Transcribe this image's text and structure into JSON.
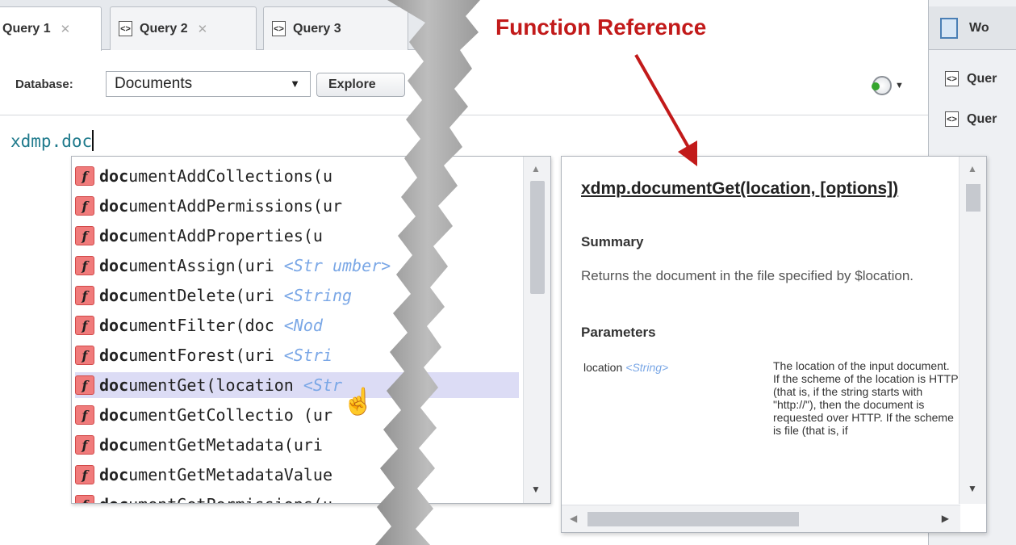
{
  "tabs": [
    {
      "label": "Query 1",
      "active": true
    },
    {
      "label": "Query 2",
      "active": false
    },
    {
      "label": "Query 3",
      "active": false
    }
  ],
  "toolbar": {
    "database_label": "Database:",
    "database_value": "Documents",
    "explore_label": "Explore"
  },
  "editor": {
    "code": "xdmp.doc"
  },
  "autocomplete": {
    "typed_prefix": "doc",
    "items": [
      {
        "rest": "umentAddCollections(u",
        "param": "",
        "selected": false
      },
      {
        "rest": "umentAddPermissions(ur",
        "param": "",
        "selected": false
      },
      {
        "rest": "umentAddProperties(u",
        "param": "",
        "selected": false
      },
      {
        "rest": "umentAssign(uri",
        "param": "<Str          umber>",
        "selected": false
      },
      {
        "rest": "umentDelete(uri",
        "param": "<String",
        "selected": false
      },
      {
        "rest": "umentFilter(doc",
        "param": "<Nod",
        "selected": false
      },
      {
        "rest": "umentForest(uri",
        "param": "<Stri",
        "selected": false
      },
      {
        "rest": "umentGet(location",
        "param": "<Str",
        "selected": true
      },
      {
        "rest": "umentGetCollectio  (ur",
        "param": "",
        "selected": false
      },
      {
        "rest": "umentGetMetadata(uri",
        "param": "",
        "selected": false
      },
      {
        "rest": "umentGetMetadataValue",
        "param": "",
        "selected": false
      },
      {
        "rest": "umentGetPermissions(u",
        "param": "",
        "selected": false
      }
    ]
  },
  "workspace": {
    "title": "Wo",
    "items": [
      "Quer",
      "Quer"
    ]
  },
  "doc_popup": {
    "title": "xdmp.documentGet(location, [options])",
    "summary_heading": "Summary",
    "summary_text": "Returns the document in the file specified by $location.",
    "parameters_heading": "Parameters",
    "param_name": "location",
    "param_type": "<String>",
    "param_desc": "The location of the input document. If the scheme of the location is HTTP (that is, if the string starts with \"http://\"), then the document is requested over HTTP. If the scheme is file (that is, if"
  },
  "annotation": {
    "label": "Function Reference",
    "color": "#c21a1a"
  },
  "icons": {
    "query": "query-tab-icon",
    "function": "function-icon",
    "history": "history-icon",
    "workspace": "workspace-book-icon",
    "cursor": "hand-pointer-icon"
  }
}
